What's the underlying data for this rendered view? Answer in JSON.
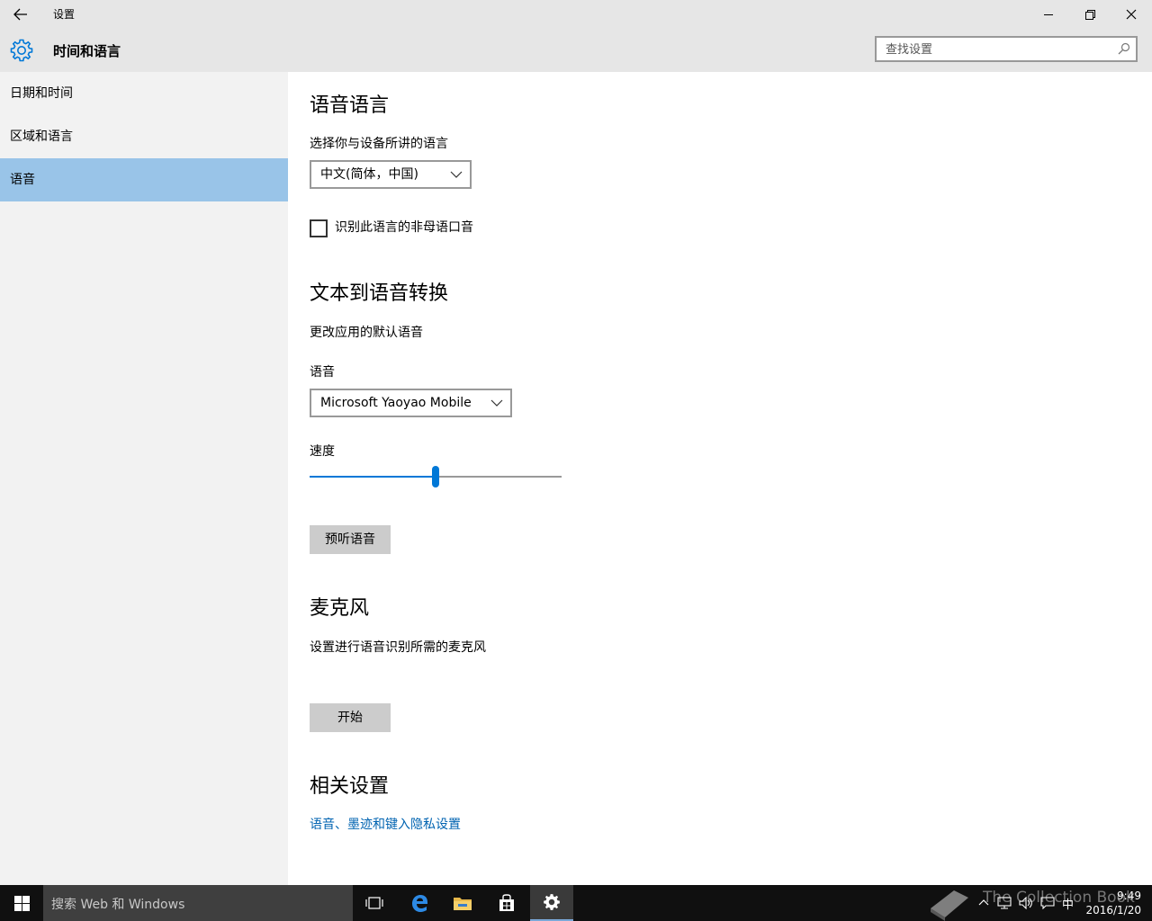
{
  "window": {
    "title": "设置",
    "back_icon": "back-arrow-icon",
    "minimize_icon": "minimize-icon",
    "restore_icon": "restore-icon",
    "close_icon": "close-icon"
  },
  "header": {
    "icon": "gear-icon",
    "title": "时间和语言",
    "search_placeholder": "查找设置"
  },
  "sidebar": {
    "items": [
      {
        "label": "日期和时间",
        "active": false
      },
      {
        "label": "区域和语言",
        "active": false
      },
      {
        "label": "语音",
        "active": true
      }
    ]
  },
  "speech_language": {
    "heading": "语音语言",
    "prompt": "选择你与设备所讲的语言",
    "selected": "中文(简体，中国)",
    "checkbox_label": "识别此语言的非母语口音",
    "checkbox_checked": false
  },
  "tts": {
    "heading": "文本到语音转换",
    "description": "更改应用的默认语音",
    "voice_label": "语音",
    "voice_selected": "Microsoft Yaoyao Mobile",
    "speed_label": "速度",
    "speed_value": 0.5,
    "preview_button": "预听语音"
  },
  "microphone": {
    "heading": "麦克风",
    "description": "设置进行语音识别所需的麦克风",
    "start_button": "开始"
  },
  "related": {
    "heading": "相关设置",
    "link": "语音、墨迹和键入隐私设置"
  },
  "taskbar": {
    "search_placeholder": "搜索 Web 和 Windows",
    "apps": [
      "task-view-icon",
      "edge-icon",
      "file-explorer-icon",
      "store-icon",
      "settings-gear-icon"
    ],
    "watermark": "The Collection Book",
    "ime": "中",
    "time": "9:49",
    "date": "2016/1/20"
  },
  "colors": {
    "accent": "#0078d7",
    "selected_nav": "#99c4e8",
    "link": "#0063b1",
    "titlebar": "#e6e6e6",
    "sidebar": "#f2f2f2",
    "taskbar": "#101010"
  }
}
